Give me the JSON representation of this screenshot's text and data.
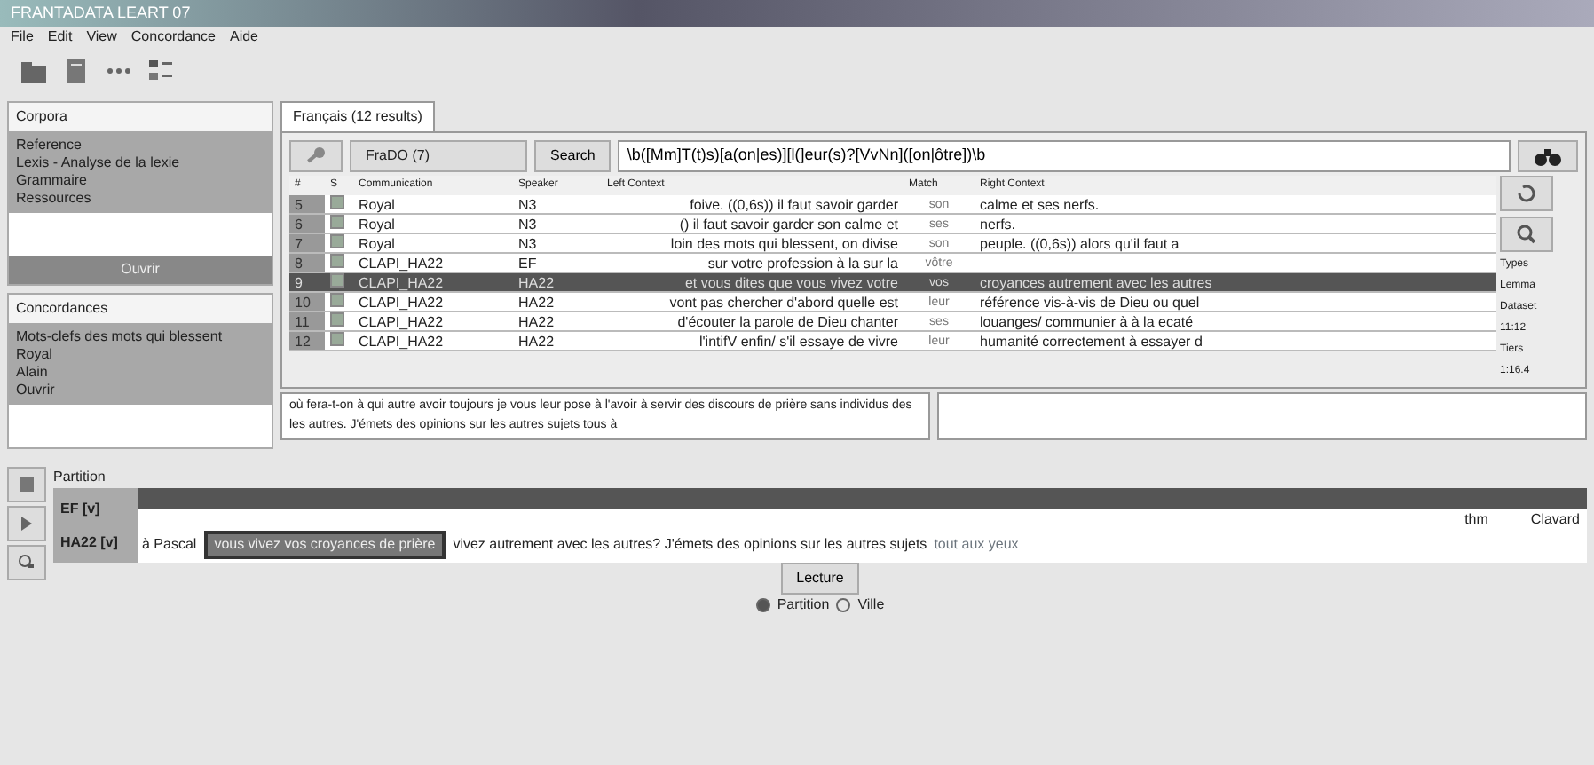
{
  "window": {
    "title": "FRANTADATA LEART 07"
  },
  "menu": [
    "File",
    "Edit",
    "View",
    "Concordance",
    "Aide"
  ],
  "corpora": {
    "title": "Corpora",
    "items": [
      "Reference",
      "Lexis - Analyse de la lexie",
      "Grammaire",
      "Ressources"
    ],
    "button": "Ouvrir"
  },
  "concordances": {
    "title": "Concordances",
    "items": [
      "Mots-clefs des mots qui blessent",
      "Royal",
      "Alain",
      "Ouvrir"
    ]
  },
  "tab": {
    "label": "Français (12 results)",
    "selected": true
  },
  "search": {
    "dropdown": "FraDO (7)",
    "button": "Search",
    "query": "\\b([Mm]T(t)s)[a(on|es)][l(]eur(s)?[VvNn]([on|ôtre])\\b"
  },
  "table": {
    "columns": [
      "#",
      "S",
      "Communication",
      "Speaker",
      "Left Context",
      "Match",
      "Right Context"
    ],
    "rows": [
      {
        "num": "5",
        "checked": true,
        "communication": "Royal",
        "speaker": "N3",
        "left": "foive. ((0,6s)) il faut savoir garder",
        "match": "son",
        "right": "calme et ses nerfs.",
        "selected": false
      },
      {
        "num": "6",
        "checked": true,
        "communication": "Royal",
        "speaker": "N3",
        "left": "() il faut savoir garder son calme et",
        "match": "ses",
        "right": "nerfs.",
        "selected": false
      },
      {
        "num": "7",
        "checked": true,
        "communication": "Royal",
        "speaker": "N3",
        "left": "loin des mots qui blessent, on divise",
        "match": "son",
        "right": "peuple. ((0,6s)) alors qu'il faut a",
        "selected": false
      },
      {
        "num": "8",
        "checked": true,
        "communication": "CLAPI_HA22",
        "speaker": "EF",
        "left": "sur votre profession à la sur la",
        "match": "vôtre",
        "right": "",
        "selected": false
      },
      {
        "num": "9",
        "checked": true,
        "communication": "CLAPI_HA22",
        "speaker": "HA22",
        "left": "et vous dites que vous vivez votre",
        "match": "vos",
        "right": "croyances autrement avec les autres",
        "selected": true
      },
      {
        "num": "10",
        "checked": true,
        "communication": "CLAPI_HA22",
        "speaker": "HA22",
        "left": "vont pas chercher d'abord quelle est",
        "match": "leur",
        "right": "référence vis-à-vis de Dieu ou quel",
        "selected": false
      },
      {
        "num": "11",
        "checked": true,
        "communication": "CLAPI_HA22",
        "speaker": "HA22",
        "left": "d'écouter la parole de Dieu chanter",
        "match": "ses",
        "right": "louanges/ communier à à la ecaté",
        "selected": false
      },
      {
        "num": "12",
        "checked": true,
        "communication": "CLAPI_HA22",
        "speaker": "HA22",
        "left": "l'intifV enfin/ s'il essaye de vivre",
        "match": "leur",
        "right": "humanité correctement à essayer d",
        "selected": false
      }
    ]
  },
  "side_labels": [
    "Types",
    "Lemma",
    "Dataset",
    "11:12",
    "Tiers",
    "1:16.4"
  ],
  "context_text": "où fera-t-on à qui autre avoir toujours je vous leur pose à l'avoir à servir des discours de prière sans individus des les autres. J'émets des opinions sur les autres sujets tous à",
  "partition": {
    "label": "Partition",
    "tiers": [
      "EF [v]",
      "HA22 [v]"
    ],
    "times": [
      "thm",
      "Clavard"
    ],
    "before": "à Pascal",
    "highlight": "vous vivez vos croyances de prière",
    "after": "vivez autrement avec les autres? J'émets des opinions sur les autres sujets",
    "tail": "tout aux yeux",
    "button": "Lecture"
  },
  "view_options": [
    {
      "label": "Partition",
      "selected": true
    },
    {
      "label": "Ville",
      "selected": false
    }
  ]
}
